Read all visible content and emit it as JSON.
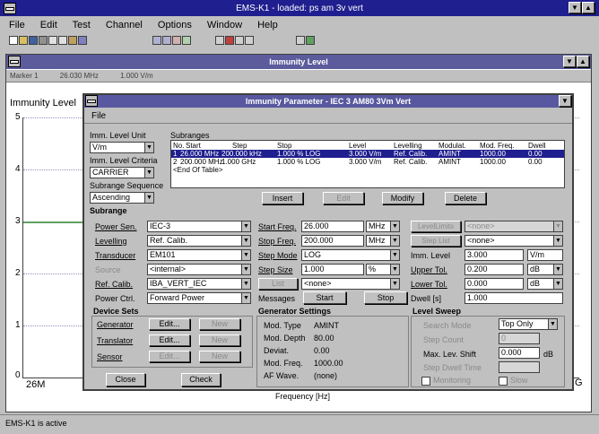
{
  "app": {
    "title": "EMS-K1 - loaded: ps am 3v vert",
    "status": "EMS-K1 is active"
  },
  "menu": [
    "File",
    "Edit",
    "Test",
    "Channel",
    "Options",
    "Window",
    "Help"
  ],
  "immunity_window": {
    "title": "Immunity Level",
    "readout": [
      "Marker 1",
      "26.030 MHz",
      "1.000 V/m"
    ],
    "graph_title": "Immunity Level",
    "y_ticks": [
      "5",
      "4",
      "3",
      "2",
      "1",
      "0"
    ],
    "x_left": "26M",
    "x_right": "G",
    "x_label": "Frequency [Hz]"
  },
  "dialog": {
    "title": "Immunity Parameter - IEC 3 AM80 3Vm Vert",
    "menu_file": "File",
    "imm_level_unit_label": "Imm. Level Unit",
    "imm_level_unit_value": "V/m",
    "imm_level_criteria_label": "Imm. Level Criteria",
    "imm_level_criteria_value": "CARRIER",
    "subrange_sequence_label": "Subrange Sequence",
    "subrange_sequence_value": "Ascending",
    "subrange_label": "Subrange",
    "subranges": {
      "title": "Subranges",
      "headers": [
        "No.",
        "Start",
        "Step",
        "Stop",
        "Level",
        "Levelling",
        "Modulat.",
        "Mod. Freq.",
        "Dwell"
      ],
      "rows": [
        [
          "1",
          "26.000 MHz",
          "200.000 kHz",
          "1.000 % LOG",
          "3.000 V/m",
          "Ref. Calib.",
          "AMINT",
          "1000.00",
          "0.00"
        ],
        [
          "2",
          "200.000 MHz",
          "1.000 GHz",
          "1.000 % LOG",
          "3.000 V/m",
          "Ref. Calib.",
          "AMINT",
          "1000.00",
          "0.00"
        ]
      ],
      "end": "<End Of Table>"
    },
    "buttons": {
      "insert": "Insert",
      "edit": "Edit",
      "modify": "Modify",
      "delete": "Delete"
    },
    "left": {
      "power_sen_label": "Power Sen.",
      "power_sen_value": "IEC-3",
      "levelling_label": "Levelling",
      "levelling_value": "Ref. Calib.",
      "transducer_label": "Transducer",
      "transducer_value": "EM101",
      "source_label": "Source",
      "source_value": "<internal>",
      "ref_calib_label": "Ref. Calib.",
      "ref_calib_value": "IBA_VERT_IEC",
      "power_ctrl_label": "Power Ctrl.",
      "power_ctrl_value": "Forward Power"
    },
    "mid": {
      "start_freq_label": "Start Freq.",
      "start_freq_value": "26.000",
      "start_freq_unit": "MHz",
      "stop_freq_label": "Stop Freq.",
      "stop_freq_value": "200.000",
      "stop_freq_unit": "MHz",
      "step_mode_label": "Step Mode",
      "step_mode_value": "LOG",
      "step_size_label": "Step Size",
      "step_size_value": "1.000",
      "step_size_unit": "%",
      "list_label": "List",
      "list_value": "<none>",
      "messages_label": "Messages",
      "start_btn": "Start",
      "stop_btn": "Stop"
    },
    "right": {
      "level_blank": "LevelLimits",
      "level_none": "<none>",
      "list2_label": "Step List",
      "list2_value": "<none>",
      "imm_level_label": "Imm. Level",
      "imm_level_value": "3.000",
      "imm_level_unit": "V/m",
      "upper_tol_label": "Upper Tol.",
      "upper_tol_value": "0.200",
      "upper_tol_unit": "dB",
      "lower_tol_label": "Lower Tol.",
      "lower_tol_value": "0.000",
      "lower_tol_unit": "dB",
      "dwell_label": "Dwell [s]",
      "dwell_value": "1.000"
    },
    "device_sets": {
      "title": "Device Sets",
      "generator": "Generator",
      "translator": "Translator",
      "sensor": "Sensor",
      "edit": "Edit...",
      "new": "New"
    },
    "generator_settings": {
      "title": "Generator Settings",
      "mod_type_label": "Mod. Type",
      "mod_type_value": "AMINT",
      "mod_depth_label": "Mod. Depth",
      "mod_depth_value": "80.00",
      "deviat_label": "Deviat.",
      "deviat_value": "0.00",
      "mod_freq_label": "Mod. Freq.",
      "mod_freq_value": "1000.00",
      "af_wave_label": "AF Wave.",
      "af_wave_value": "(none)"
    },
    "level_sweep": {
      "title": "Level Sweep",
      "search_mode_label": "Search Mode",
      "search_mode_value": "Top Only",
      "step_count_label": "Step Count",
      "step_count_value": "0",
      "max_lev_shift_label": "Max. Lev. Shift",
      "max_lev_shift_value": "0.000",
      "max_lev_shift_unit": "dB",
      "step_dwell_label": "Step Dwell Time",
      "monitoring_label": "Monitoring",
      "slow_label": "Slow"
    },
    "close_btn": "Close",
    "check_btn": "Check"
  }
}
